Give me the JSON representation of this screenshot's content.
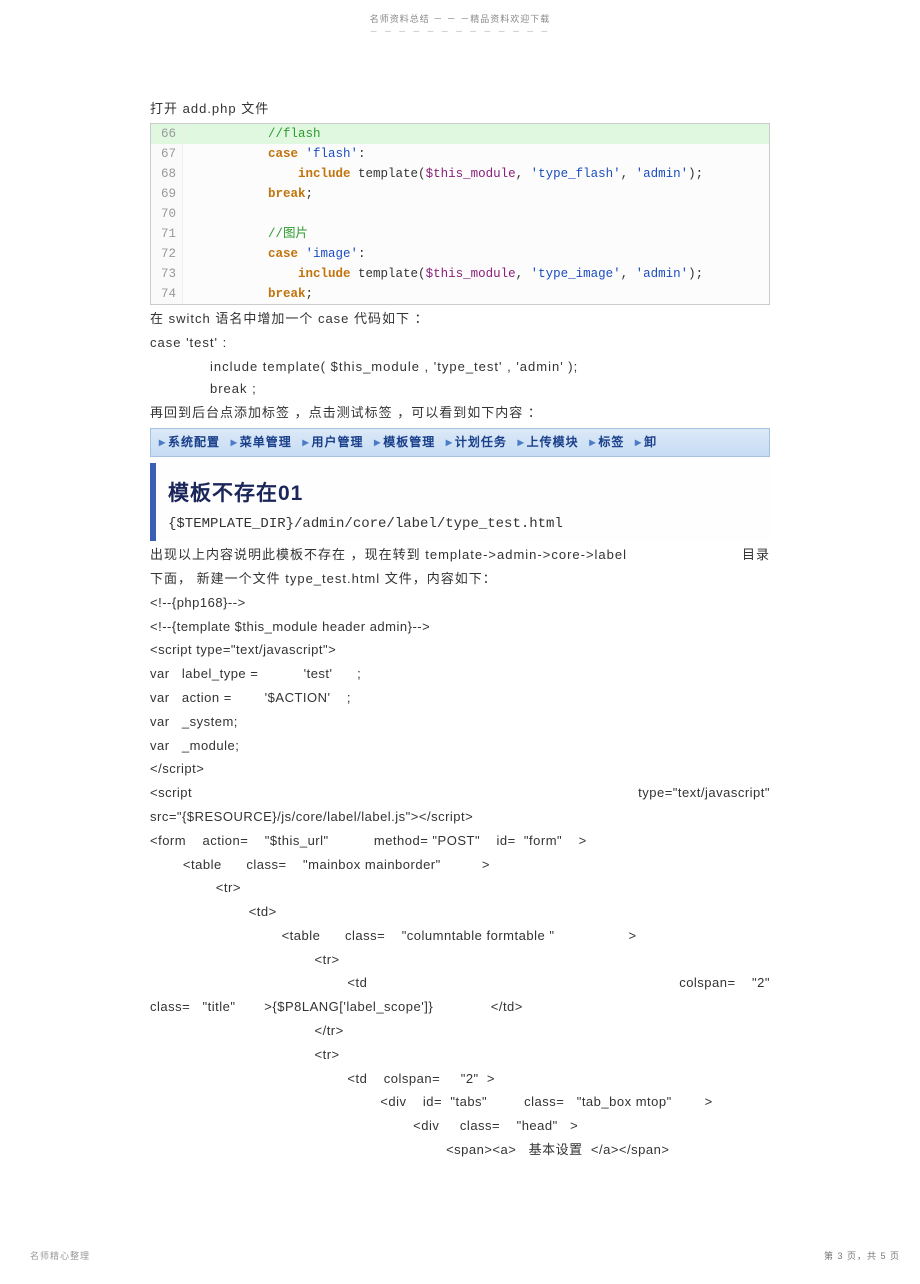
{
  "header": {
    "top": "名师资料总结 － － －精品资料欢迎下载",
    "dashes": "－ － － － － － － － － － － － －"
  },
  "para": {
    "p1_a": "打开 ",
    "p1_b": "add.php",
    "p1_c": "   文件"
  },
  "code1": {
    "rows": [
      {
        "ln": "66",
        "comment": "//flash",
        "hl": true
      },
      {
        "ln": "67",
        "kw": "case",
        "str": " 'flash'",
        "rest": ":"
      },
      {
        "ln": "68",
        "kw": "include",
        "inc_pre": " template(",
        "var": "$this_module",
        "inc_mid": ", ",
        "str1": "'type_flash'",
        "inc_mid2": ", ",
        "str2": "'admin'",
        "inc_post": ");"
      },
      {
        "ln": "69",
        "kw": "break",
        "rest": ";"
      },
      {
        "ln": "70"
      },
      {
        "ln": "71",
        "comment": "//图片"
      },
      {
        "ln": "72",
        "kw": "case",
        "str": " 'image'",
        "rest": ":"
      },
      {
        "ln": "73",
        "kw": "include",
        "inc_pre": " template(",
        "var": "$this_module",
        "inc_mid": ", ",
        "str1": "'type_image'",
        "inc_mid2": ", ",
        "str2": "'admin'",
        "inc_post": ");"
      },
      {
        "ln": "74",
        "kw": "break",
        "rest": ";"
      }
    ]
  },
  "para2": "在 switch   语名中增加一个   case 代码如下 ：",
  "snippet": {
    "l1": "case   'test'       :",
    "l2": "include     template(     $this_module     ,  'type_test'        ,   'admin'   );",
    "l3": "break  ;"
  },
  "para3": "再回到后台点添加标签   ，点击测试标签 ，可以看到如下内容  ：",
  "menu": {
    "items": [
      "系统配置",
      "菜单管理",
      "用户管理",
      "模板管理",
      "计划任务",
      "上传模块",
      "标签",
      "卸"
    ]
  },
  "error": {
    "title": "模板不存在01",
    "path": "{$TEMPLATE_DIR}/admin/core/label/type_test.html"
  },
  "para4a": "出现以上内容说明此模板不存在   ，现在转到  template->admin->core->label",
  "para4b": "目录",
  "para5": "下面， 新建一个文件  type_test.html          文件，内容如下：",
  "codelines": [
    "<!--{php168}-->",
    "<!--{template $this_module header admin}-->",
    "<script type=\"text/javascript\">",
    "var   label_type =           'test'      ;",
    "var   action =        '$ACTION'    ;",
    "var   _system;",
    "var   _module;",
    "</script>",
    "<script                                                                          type=\"text/javascript\"",
    "src=\"{$RESOURCE}/js/core/label/label.js\"></script>",
    "<form    action=    \"$this_url\"           method= \"POST\"    id=  \"form\"    >",
    "        <table      class=    \"mainbox mainborder\"          >",
    "                <tr>",
    "                        <td>",
    "                                <table      class=    \"columntable formtable \"                  >",
    "                                        <tr>",
    "                                                <td                                                                      colspan=    \"2\"",
    "class=   \"title\"       >{$P8LANG['label_scope']}              </td>",
    "                                        </tr>",
    "                                        <tr>",
    "                                                <td    colspan=     \"2\"  >",
    "                                                        <div    id=  \"tabs\"         class=   \"tab_box mtop\"        >",
    "                                                                <div     class=    \"head\"   >",
    "                                                                        <span><a>   基本设置  </a></span>"
  ],
  "footer": {
    "left": "名师精心整理",
    "right": "第 3 页，共 5 页"
  }
}
